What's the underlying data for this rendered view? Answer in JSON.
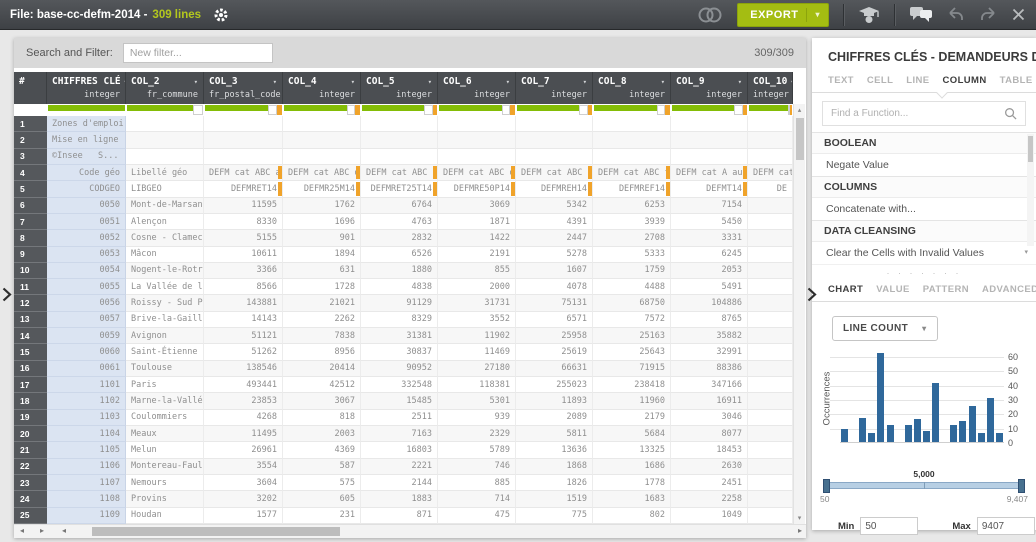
{
  "topbar": {
    "file_label": "File: base-cc-defm-2014 -",
    "lines_label": "309 lines",
    "export_label": "EXPORT"
  },
  "filter_bar": {
    "label": "Search and Filter:",
    "placeholder": "New filter...",
    "count": "309/309"
  },
  "table": {
    "index_header": "#",
    "columns": [
      {
        "name": "CHIFFRES CLÉ",
        "type": "integer",
        "quality": [
          100,
          0,
          0
        ]
      },
      {
        "name": "COL_2",
        "type": "fr_commune",
        "quality": [
          87,
          13,
          0
        ]
      },
      {
        "name": "COL_3",
        "type": "fr_postal_code",
        "quality": [
          82,
          11,
          7
        ]
      },
      {
        "name": "COL_4",
        "type": "integer",
        "quality": [
          83,
          11,
          6
        ]
      },
      {
        "name": "COL_5",
        "type": "integer",
        "quality": [
          83,
          11,
          6
        ]
      },
      {
        "name": "COL_6",
        "type": "integer",
        "quality": [
          83,
          11,
          6
        ]
      },
      {
        "name": "COL_7",
        "type": "integer",
        "quality": [
          83,
          11,
          6
        ]
      },
      {
        "name": "COL_8",
        "type": "integer",
        "quality": [
          83,
          11,
          6
        ]
      },
      {
        "name": "COL_9",
        "type": "integer",
        "quality": [
          83,
          11,
          6
        ]
      },
      {
        "name": "COL_10",
        "type": "integer",
        "quality": [
          90,
          6,
          4
        ]
      }
    ],
    "rows": [
      {
        "num": "1",
        "cells": [
          "Zones d'emploi...",
          "",
          "",
          "",
          "",
          "",
          "",
          "",
          "",
          ""
        ]
      },
      {
        "num": "2",
        "cells": [
          "Mise en ligne ...",
          "",
          "",
          "",
          "",
          "",
          "",
          "",
          "",
          ""
        ]
      },
      {
        "num": "3",
        "cells": [
          "©Insee   S...",
          "",
          "",
          "",
          "",
          "",
          "",
          "",
          "",
          ""
        ]
      },
      {
        "num": "4",
        "cells": [
          "Code géo",
          "Libellé géo",
          "DEFM cat ABC a...",
          "DEFM cat ABC d...",
          "DEFM cat ABC d...",
          "DEFM cat ABC d...",
          "DEFM cat ABC h...",
          "DEFM cat ABC f...",
          "DEFM cat A au ...",
          "DEFM cat A"
        ],
        "invalid": [
          2,
          3,
          4,
          5,
          6,
          7,
          8
        ]
      },
      {
        "num": "5",
        "cells": [
          "CODGEO",
          "LIBGEO",
          "DEFMRET14",
          "DEFMR25M14",
          "DEFMRET25T14",
          "DEFMRE50P14",
          "DEFMREH14",
          "DEFMREF14",
          "DEFMT14",
          "DE"
        ],
        "invalid": [
          2,
          3,
          4,
          5,
          6,
          7,
          8
        ]
      },
      {
        "num": "6",
        "cells": [
          "0050",
          "Mont-de-Marsan",
          "11595",
          "1762",
          "6764",
          "3069",
          "5342",
          "6253",
          "7154",
          ""
        ]
      },
      {
        "num": "7",
        "cells": [
          "0051",
          "Alençon",
          "8330",
          "1696",
          "4763",
          "1871",
          "4391",
          "3939",
          "5450",
          ""
        ]
      },
      {
        "num": "8",
        "cells": [
          "0052",
          "Cosne - Clamecy",
          "5155",
          "901",
          "2832",
          "1422",
          "2447",
          "2708",
          "3331",
          ""
        ]
      },
      {
        "num": "9",
        "cells": [
          "0053",
          "Mâcon",
          "10611",
          "1894",
          "6526",
          "2191",
          "5278",
          "5333",
          "6245",
          ""
        ]
      },
      {
        "num": "10",
        "cells": [
          "0054",
          "Nogent-le-Rotrou",
          "3366",
          "631",
          "1880",
          "855",
          "1607",
          "1759",
          "2053",
          ""
        ]
      },
      {
        "num": "11",
        "cells": [
          "0055",
          "La Vallée de l...",
          "8566",
          "1728",
          "4838",
          "2000",
          "4078",
          "4488",
          "5491",
          ""
        ]
      },
      {
        "num": "12",
        "cells": [
          "0056",
          "Roissy - Sud P...",
          "143881",
          "21021",
          "91129",
          "31731",
          "75131",
          "68750",
          "104886",
          ""
        ]
      },
      {
        "num": "13",
        "cells": [
          "0057",
          "Brive-la-Gaill...",
          "14143",
          "2262",
          "8329",
          "3552",
          "6571",
          "7572",
          "8765",
          ""
        ]
      },
      {
        "num": "14",
        "cells": [
          "0059",
          "Avignon",
          "51121",
          "7838",
          "31381",
          "11902",
          "25958",
          "25163",
          "35882",
          ""
        ]
      },
      {
        "num": "15",
        "cells": [
          "0060",
          "Saint-Étienne",
          "51262",
          "8956",
          "30837",
          "11469",
          "25619",
          "25643",
          "32991",
          ""
        ]
      },
      {
        "num": "16",
        "cells": [
          "0061",
          "Toulouse",
          "138546",
          "20414",
          "90952",
          "27180",
          "66631",
          "71915",
          "88386",
          ""
        ]
      },
      {
        "num": "17",
        "cells": [
          "1101",
          "Paris",
          "493441",
          "42512",
          "332548",
          "118381",
          "255023",
          "238418",
          "347166",
          ""
        ]
      },
      {
        "num": "18",
        "cells": [
          "1102",
          "Marne-la-Vallée",
          "23853",
          "3067",
          "15485",
          "5301",
          "11893",
          "11960",
          "16911",
          ""
        ]
      },
      {
        "num": "19",
        "cells": [
          "1103",
          "Coulommiers",
          "4268",
          "818",
          "2511",
          "939",
          "2089",
          "2179",
          "3046",
          ""
        ]
      },
      {
        "num": "20",
        "cells": [
          "1104",
          "Meaux",
          "11495",
          "2003",
          "7163",
          "2329",
          "5811",
          "5684",
          "8077",
          ""
        ]
      },
      {
        "num": "21",
        "cells": [
          "1105",
          "Melun",
          "26961",
          "4369",
          "16803",
          "5789",
          "13636",
          "13325",
          "18453",
          ""
        ]
      },
      {
        "num": "22",
        "cells": [
          "1106",
          "Montereau-Faul...",
          "3554",
          "587",
          "2221",
          "746",
          "1868",
          "1686",
          "2630",
          ""
        ]
      },
      {
        "num": "23",
        "cells": [
          "1107",
          "Nemours",
          "3604",
          "575",
          "2144",
          "885",
          "1826",
          "1778",
          "2451",
          ""
        ]
      },
      {
        "num": "24",
        "cells": [
          "1108",
          "Provins",
          "3202",
          "605",
          "1883",
          "714",
          "1519",
          "1683",
          "2258",
          ""
        ]
      },
      {
        "num": "25",
        "cells": [
          "1109",
          "Houdan",
          "1577",
          "231",
          "871",
          "475",
          "775",
          "802",
          "1049",
          ""
        ]
      }
    ]
  },
  "panel": {
    "title": "CHIFFRES CLÉS - DEMANDEURS D'...",
    "tabs": [
      "TEXT",
      "CELL",
      "LINE",
      "COLUMN",
      "TABLE"
    ],
    "active_tab": "COLUMN",
    "search_placeholder": "Find a Function...",
    "sections": [
      {
        "header": "BOOLEAN",
        "items": [
          "Negate Value"
        ]
      },
      {
        "header": "COLUMNS",
        "items": [
          "Concatenate with..."
        ]
      },
      {
        "header": "DATA CLEANSING",
        "items": [
          "Clear the Cells with Invalid Values"
        ]
      }
    ],
    "stat_tabs": [
      "CHART",
      "VALUE",
      "PATTERN",
      "ADVANCED"
    ],
    "active_stat_tab": "CHART",
    "chart_selector": "LINE COUNT",
    "slider": {
      "center_label": "5,000",
      "left_label": "50",
      "right_label": "9,407"
    },
    "range": {
      "min_label": "Min",
      "min_value": "50",
      "max_label": "Max",
      "max_value": "9407"
    }
  },
  "chart_data": {
    "type": "bar",
    "title": "LINE COUNT",
    "ylabel": "Occurrences",
    "ylim": [
      0,
      60
    ],
    "yticks": [
      0,
      10,
      20,
      30,
      40,
      50,
      60
    ],
    "x_range": [
      50,
      9407
    ],
    "x_mid_label": "5,000",
    "grid": true,
    "legend": "none",
    "values": [
      9,
      0,
      17,
      6,
      62,
      12,
      0,
      12,
      16,
      8,
      41,
      0,
      12,
      15,
      25,
      6,
      31,
      6
    ]
  },
  "colors": {
    "accent_green": "#a4bd12",
    "quality_valid": "#84bd06",
    "quality_invalid": "#f0a32a",
    "bar_blue": "#2f689b",
    "selected_column_bg": "#dbe4f2"
  }
}
